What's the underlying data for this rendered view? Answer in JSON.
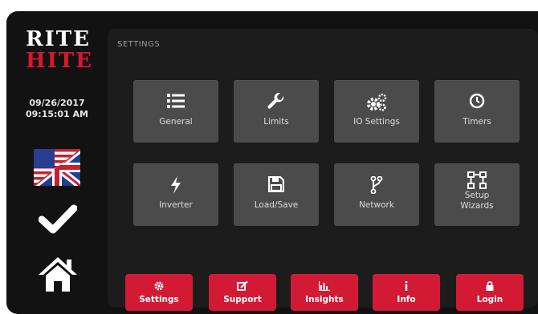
{
  "brand": {
    "line1": "RITE",
    "line2": "HITE"
  },
  "status": {
    "date": "09/26/2017",
    "time": "09:15:01 AM"
  },
  "sidebar": {
    "language_icon": "us-uk-flag-icon",
    "confirm_icon": "checkmark-icon",
    "home_icon": "home-icon"
  },
  "panel": {
    "title": "SETTINGS",
    "tiles": [
      {
        "label": "General",
        "icon": "list-icon"
      },
      {
        "label": "Limits",
        "icon": "wrench-icon"
      },
      {
        "label": "IO Settings",
        "icon": "gears-icon"
      },
      {
        "label": "Timers",
        "icon": "clock-icon"
      },
      {
        "label": "Inverter",
        "icon": "lightning-icon"
      },
      {
        "label": "Load/Save",
        "icon": "floppy-disk-icon"
      },
      {
        "label": "Network",
        "icon": "network-fork-icon"
      },
      {
        "label": "Setup",
        "label_line2": "Wizards",
        "icon": "flowchart-icon"
      }
    ]
  },
  "bottom_nav": [
    {
      "label": "Settings",
      "icon": "gear-icon"
    },
    {
      "label": "Support",
      "icon": "edit-icon"
    },
    {
      "label": "Insights",
      "icon": "bar-chart-icon"
    },
    {
      "label": "Info",
      "icon": "info-icon"
    },
    {
      "label": "Login",
      "icon": "lock-icon"
    }
  ],
  "colors": {
    "accent_red": "#d21a35",
    "tile_gray": "#4b4b4b",
    "background": "#121212",
    "panel": "#1c1c1c"
  }
}
